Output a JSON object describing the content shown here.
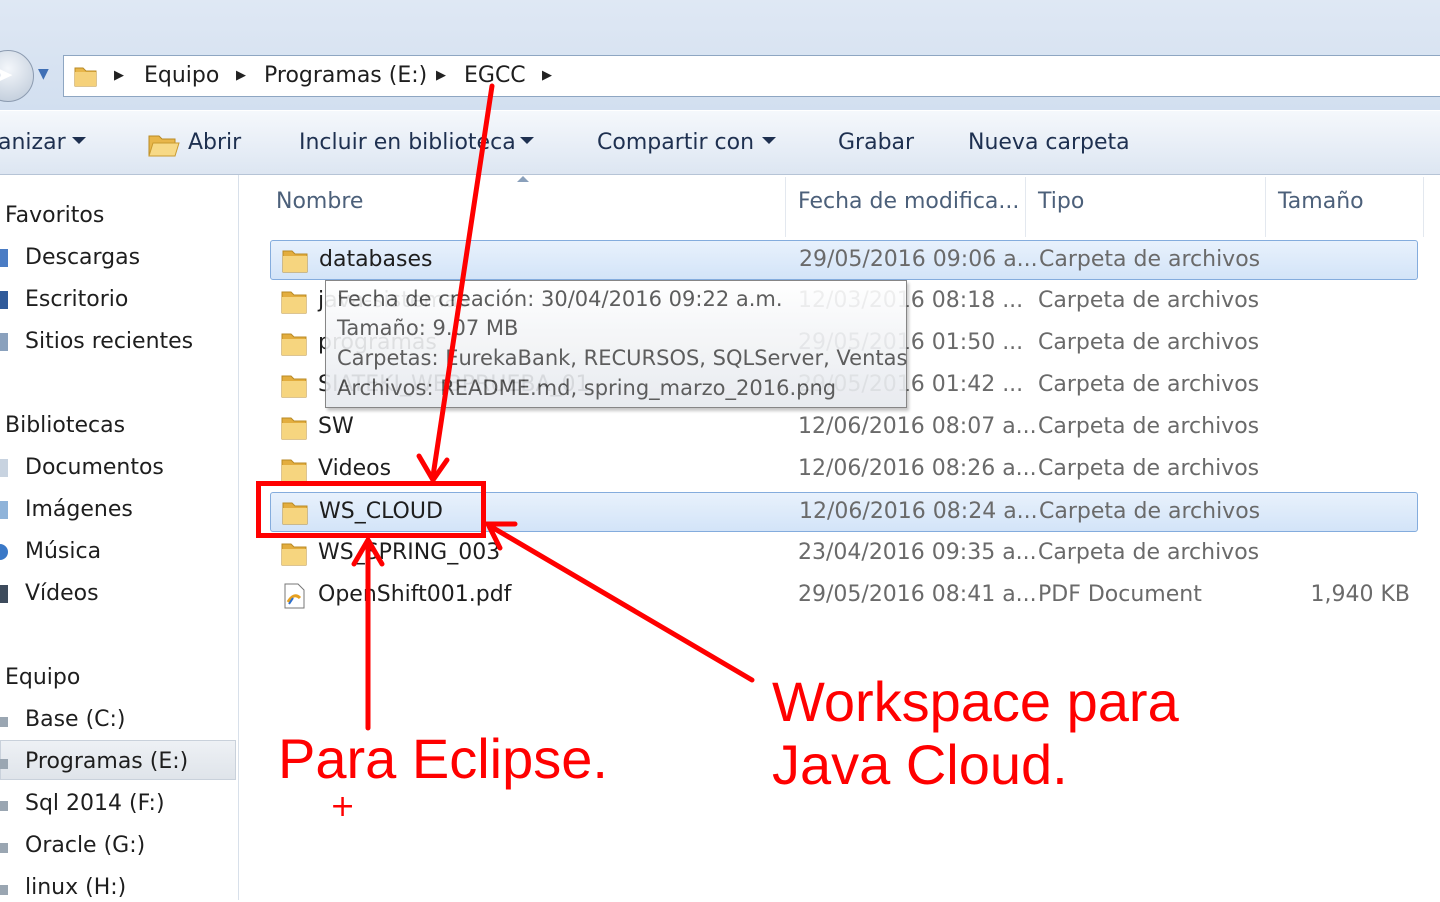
{
  "address_bar": {
    "crumbs": [
      "Equipo",
      "Programas (E:)",
      "EGCC"
    ]
  },
  "toolbar": {
    "organize": "anizar",
    "open": "Abrir",
    "include_library": "Incluir en biblioteca",
    "share_with": "Compartir con",
    "burn": "Grabar",
    "new_folder": "Nueva carpeta"
  },
  "nav": {
    "favorites_header": "Favoritos",
    "favorites": [
      "Descargas",
      "Escritorio",
      "Sitios recientes"
    ],
    "libraries_header": "Bibliotecas",
    "libraries": [
      "Documentos",
      "Imágenes",
      "Música",
      "Vídeos"
    ],
    "computer_header": "Equipo",
    "drives": [
      "Base (C:)",
      "Programas (E:)",
      "Sql 2014 (F:)",
      "Oracle (G:)",
      "linux (H:)"
    ],
    "selected_drive": "Programas (E:)"
  },
  "columns": {
    "name": "Nombre",
    "date": "Fecha de modifica...",
    "type": "Tipo",
    "size": "Tamaño"
  },
  "files": [
    {
      "name": "databases",
      "date": "29/05/2016 09:06 a...",
      "type": "Carpeta de archivos",
      "size": "",
      "icon": "folder-icon"
    },
    {
      "name": "java-sistemas",
      "date": "12/03/2016 08:18 ...",
      "type": "Carpeta de archivos",
      "size": "",
      "icon": "folder-icon"
    },
    {
      "name": "programas",
      "date": "29/05/2016 01:50 ...",
      "type": "Carpeta de archivos",
      "size": "",
      "icon": "folder-icon"
    },
    {
      "name": "SIATEKI_WEBPRUEBA_01",
      "date": "29/05/2016 01:42 ...",
      "type": "Carpeta de archivos",
      "size": "",
      "icon": "folder-icon"
    },
    {
      "name": "SW",
      "date": "12/06/2016 08:07 a...",
      "type": "Carpeta de archivos",
      "size": "",
      "icon": "folder-icon"
    },
    {
      "name": "Videos",
      "date": "12/06/2016 08:26 a...",
      "type": "Carpeta de archivos",
      "size": "",
      "icon": "folder-icon"
    },
    {
      "name": "WS_CLOUD",
      "date": "12/06/2016 08:24 a...",
      "type": "Carpeta de archivos",
      "size": "",
      "icon": "folder-icon"
    },
    {
      "name": "WS_SPRING_003",
      "date": "23/04/2016 09:35 a...",
      "type": "Carpeta de archivos",
      "size": "",
      "icon": "folder-icon"
    },
    {
      "name": "OpenShift001.pdf",
      "date": "29/05/2016 08:41 a...",
      "type": "PDF Document",
      "size": "1,940 KB",
      "icon": "pdf-file-icon"
    }
  ],
  "tooltip": {
    "line1": "Fecha de creación: 30/04/2016 09:22 a.m.",
    "line2": "Tamaño: 9.07 MB",
    "line3": "Carpetas: EurekaBank, RECURSOS, SQLServer, Ventas",
    "line4": "Archivos: README.md, spring_marzo_2016.png"
  },
  "annotations": {
    "left_line1": "Para Eclipse.",
    "right_line1": "Workspace para",
    "right_line2": "Java Cloud.",
    "cross": "+",
    "color": "#ff0000"
  },
  "colors": {
    "selection": "#d3e4f8",
    "selection_border": "#84acdd",
    "accent": "#3f6fb5"
  }
}
